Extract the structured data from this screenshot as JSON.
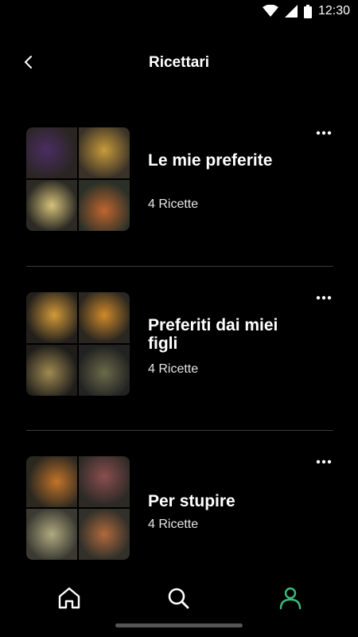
{
  "status": {
    "time": "12:30"
  },
  "header": {
    "title": "Ricettari"
  },
  "collections": [
    {
      "name": "Le mie preferite",
      "count": "4 Ricette",
      "thumbs": [
        "#3d2a4d",
        "#a8822e",
        "#c9b46a",
        "#6d3b24"
      ]
    },
    {
      "name": "Preferiti dai miei figli",
      "count": "4 Ricette",
      "thumbs": [
        "#b8862d",
        "#c07a22",
        "#8c7640",
        "#5a5a3a"
      ]
    },
    {
      "name": "Per stupire",
      "count": "4 Ricette",
      "thumbs": [
        "#b36a24",
        "#7a4a4a",
        "#9a9a70",
        "#9b5a36"
      ]
    }
  ],
  "nav": {
    "items": [
      "home-icon",
      "search-icon",
      "profile-icon"
    ],
    "active_color": "#3dba7a",
    "inactive_color": "#ffffff"
  }
}
